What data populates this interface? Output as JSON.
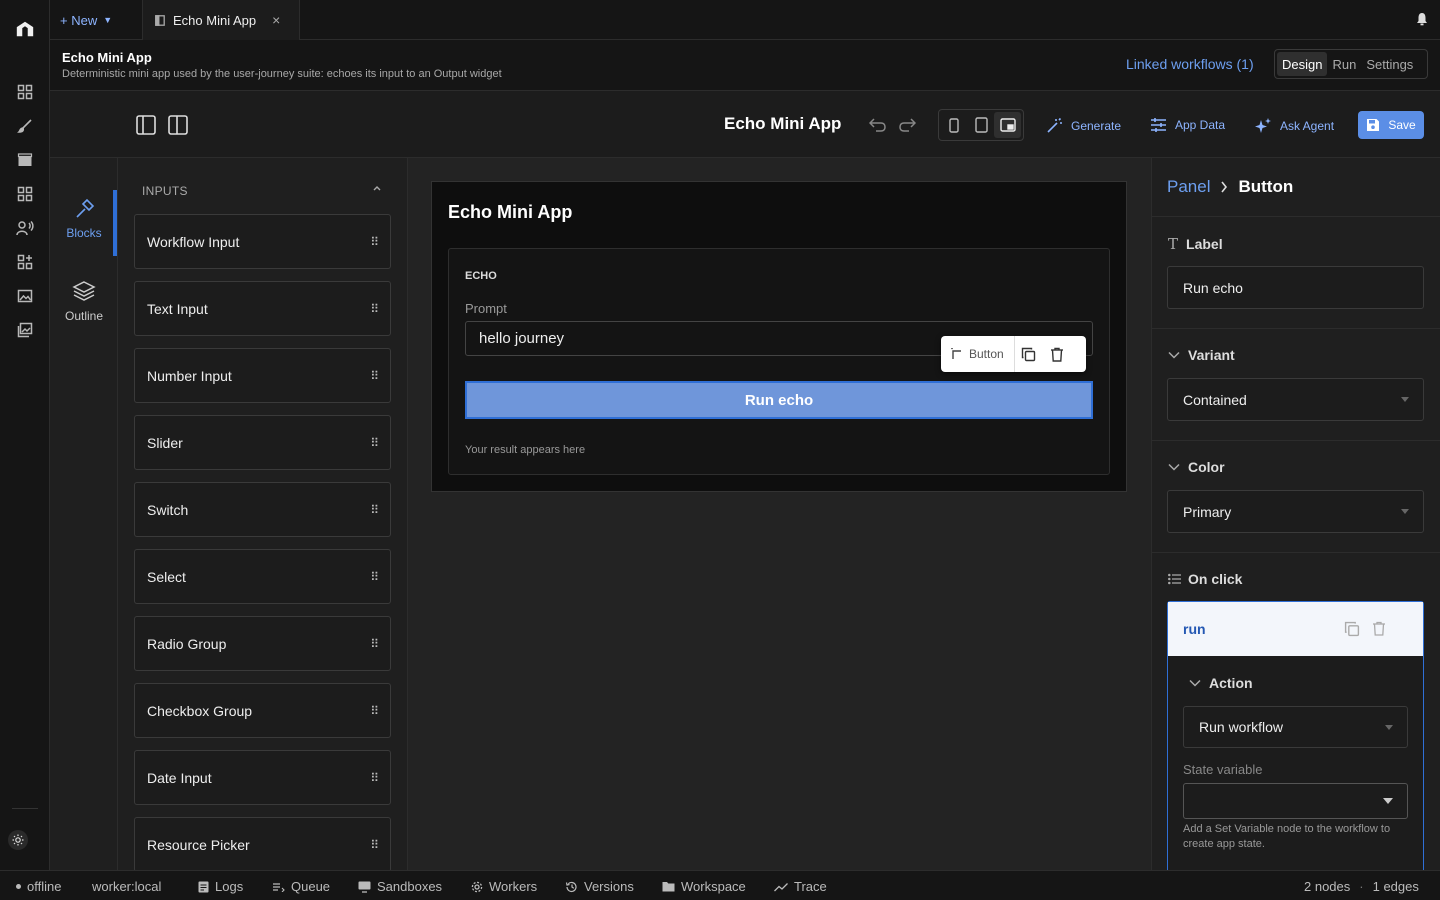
{
  "tabbar": {
    "new_label": "+ New",
    "tab_title": "Echo Mini App"
  },
  "app": {
    "title": "Echo Mini App",
    "description": "Deterministic mini app used by the user-journey suite: echoes its input to an Output widget",
    "linked_workflows": "Linked workflows (1)",
    "modes": [
      "Design",
      "Run",
      "Settings"
    ],
    "active_mode": "Design"
  },
  "strip": {
    "blocks_label": "Blocks",
    "outline_label": "Outline"
  },
  "toolbar": {
    "title": "Echo Mini App",
    "generate": "Generate",
    "app_data": "App Data",
    "ask_agent": "Ask Agent",
    "save": "Save"
  },
  "blocks": {
    "section_title": "INPUTS",
    "items": [
      "Workflow Input",
      "Text Input",
      "Number Input",
      "Slider",
      "Switch",
      "Select",
      "Radio Group",
      "Checkbox Group",
      "Date Input",
      "Resource Picker"
    ]
  },
  "canvas": {
    "app_title": "Echo Mini App",
    "panel_title": "ECHO",
    "prompt_label": "Prompt",
    "prompt_value": "hello journey",
    "button_label": "Run echo",
    "result_text": "Your result appears here",
    "popover_label": "Button"
  },
  "inspector": {
    "breadcrumb_parent": "Panel",
    "breadcrumb_current": "Button",
    "label_heading": "Label",
    "label_value": "Run echo",
    "variant_heading": "Variant",
    "variant_value": "Contained",
    "color_heading": "Color",
    "color_value": "Primary",
    "onclick_heading": "On click",
    "handler_name": "run",
    "action_heading": "Action",
    "action_value": "Run workflow",
    "state_var_label": "State variable",
    "state_var_value": "",
    "state_var_help": "Add a Set Variable node to the workflow to create app state."
  },
  "statusbar": {
    "connection": "offline",
    "worker": "worker:local",
    "logs": "Logs",
    "queue": "Queue",
    "sandboxes": "Sandboxes",
    "workers": "Workers",
    "versions": "Versions",
    "workspace": "Workspace",
    "trace": "Trace",
    "nodes": "2 nodes",
    "edges": "1 edges"
  },
  "colors": {
    "accent": "#6d9ff0",
    "primary_button": "#6f96da",
    "save_button": "#5b8ee6"
  }
}
